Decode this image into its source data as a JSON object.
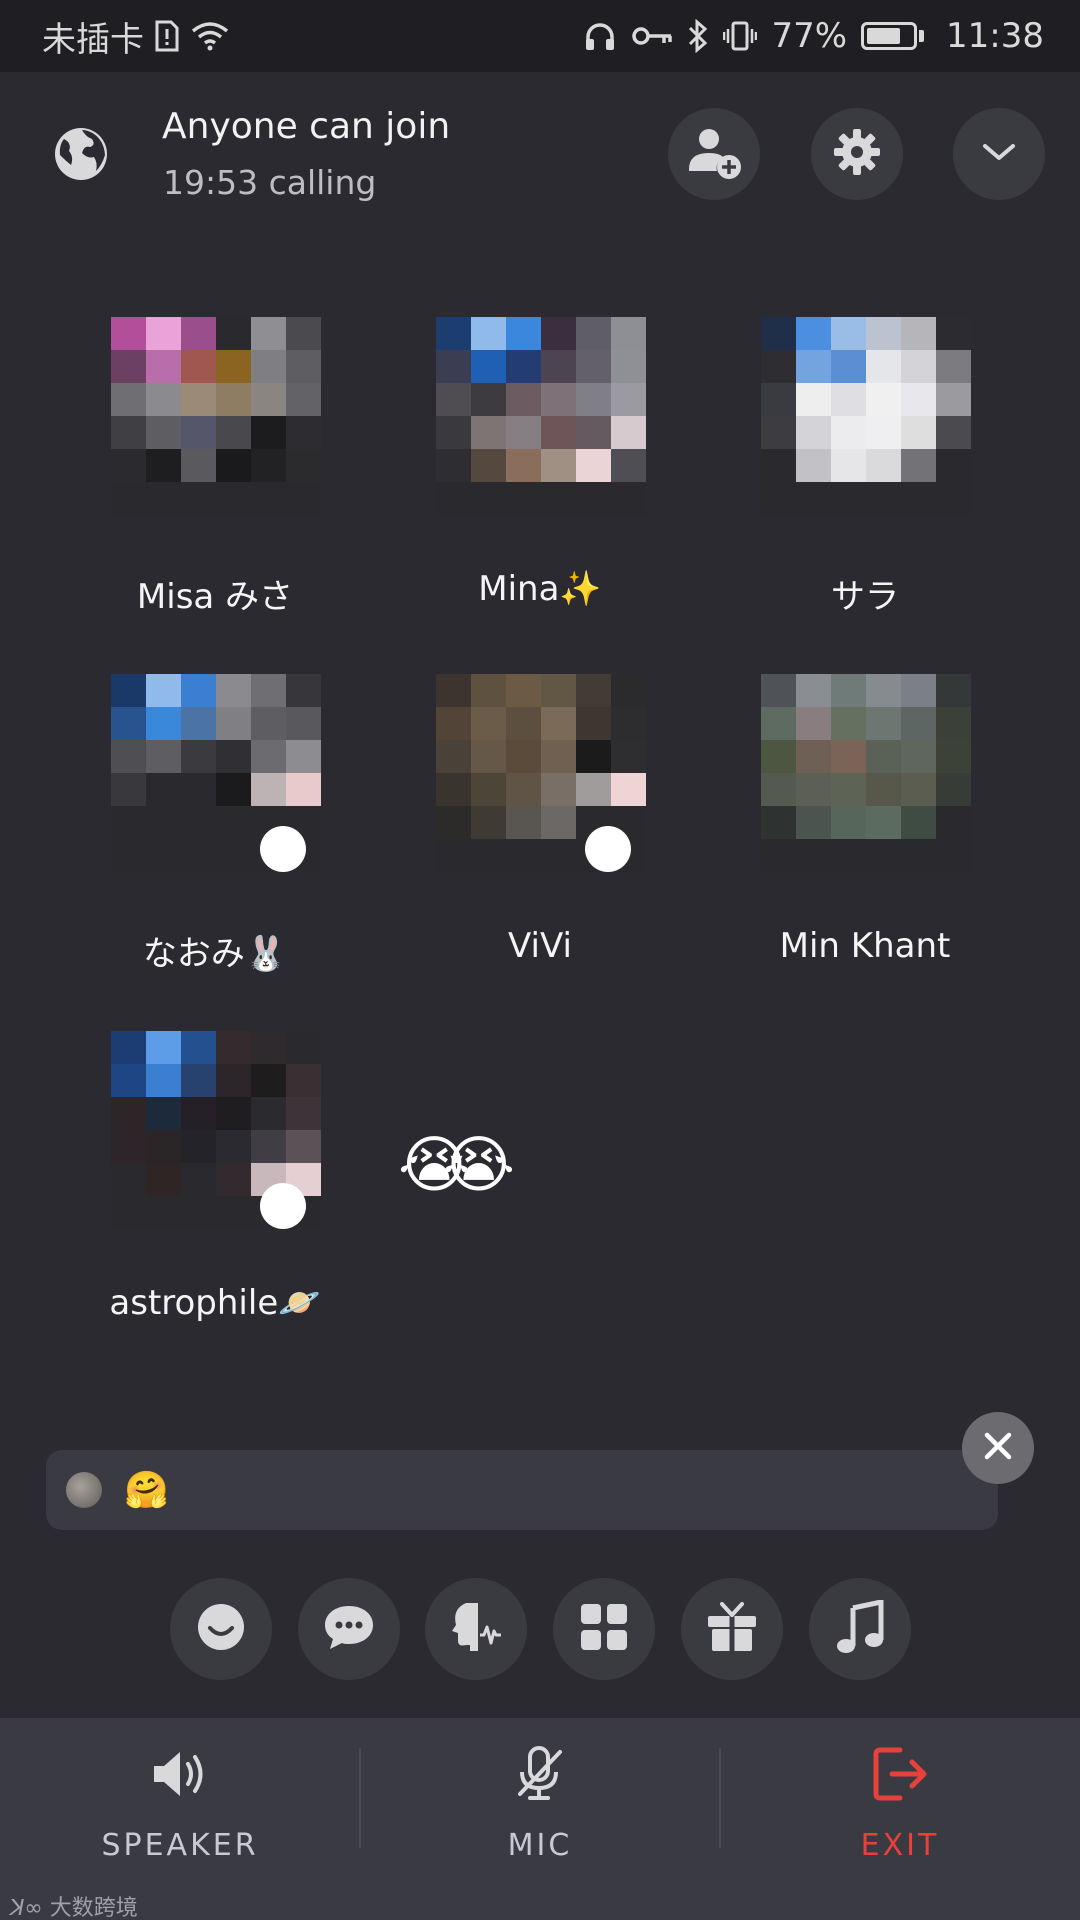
{
  "status_bar": {
    "carrier": "未插卡",
    "battery": "77%",
    "battery_level": 0.77,
    "time": "11:38",
    "icons": [
      "sim-alert-icon",
      "wifi-icon",
      "headphones-icon",
      "key-icon",
      "bluetooth-icon",
      "vibrate-icon",
      "battery-icon"
    ]
  },
  "header": {
    "title": "Anyone can join",
    "subtitle": "19:53 calling",
    "icons": [
      "globe-icon",
      "add-user-icon",
      "gear-icon",
      "chevron-down-icon"
    ]
  },
  "participants": [
    {
      "name": "Misa みさ",
      "mic_badge": false
    },
    {
      "name": "Mina✨",
      "mic_badge": false
    },
    {
      "name": "サラ",
      "mic_badge": false
    },
    {
      "name": "なおみ🐰",
      "mic_badge": true
    },
    {
      "name": "ViVi",
      "mic_badge": true
    },
    {
      "name": "Min Khant",
      "mic_badge": false
    },
    {
      "name": "astrophile🪐",
      "mic_badge": true
    }
  ],
  "reaction": "😭😭",
  "chat": {
    "message": "🤗"
  },
  "tools": [
    "emoji-icon",
    "chat-icon",
    "voice-effect-icon",
    "apps-grid-icon",
    "gift-icon",
    "music-icon"
  ],
  "bottom_nav": {
    "speaker": "SPEAKER",
    "mic": "MIC",
    "exit": "EXIT"
  },
  "colors": {
    "exit": "#e8413c",
    "background": "#2a2a30",
    "panel": "#3a3a42"
  },
  "watermark": "大数跨境"
}
